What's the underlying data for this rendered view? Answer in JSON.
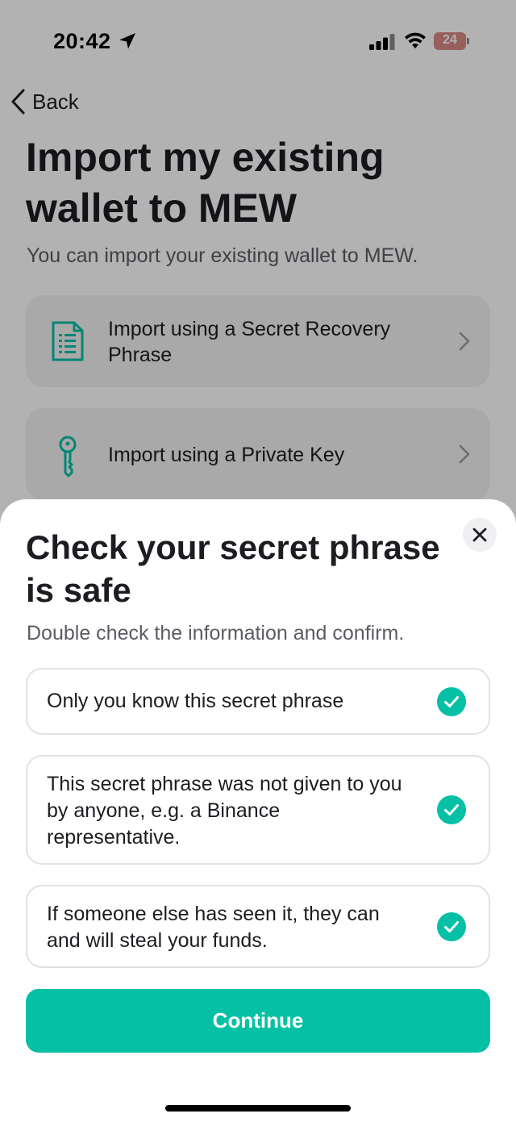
{
  "status_bar": {
    "time": "20:42",
    "battery": "24"
  },
  "nav": {
    "back_label": "Back"
  },
  "page": {
    "title": "Import my existing wallet to MEW",
    "subtitle": "You can import your existing wallet to MEW.",
    "options": [
      {
        "label": "Import using a Secret Recovery Phrase",
        "icon": "document-icon"
      },
      {
        "label": "Import using a Private Key",
        "icon": "key-icon"
      }
    ]
  },
  "sheet": {
    "title": "Check your secret phrase is safe",
    "subtitle": "Double check the information and confirm.",
    "checks": [
      {
        "text": "Only you know this secret phrase",
        "checked": true
      },
      {
        "text": "This secret phrase was not given to you by anyone, e.g. a Binance representative.",
        "checked": true
      },
      {
        "text": "If someone else has seen it, they can and will steal your funds.",
        "checked": true
      }
    ],
    "continue_label": "Continue"
  },
  "colors": {
    "accent": "#05c0a5",
    "text_primary": "#1c1d21",
    "text_secondary": "#5a5c63",
    "card_bg": "#f2f2f4"
  }
}
